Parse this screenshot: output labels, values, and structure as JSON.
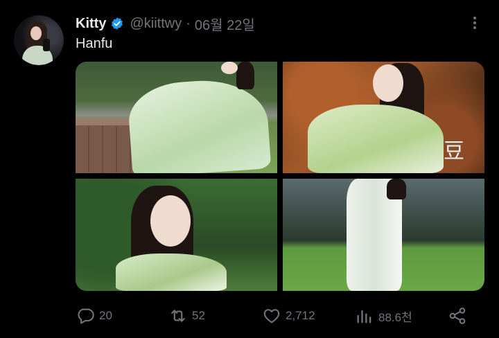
{
  "author": {
    "name": "Kitty",
    "handle": "@kiittwy",
    "separator": "·",
    "date": "06월 22일",
    "verified": true
  },
  "tweet": {
    "text": "Hanfu"
  },
  "media": {
    "photos": [
      {
        "subject": "woman in green hanfu sitting on brick wall in park"
      },
      {
        "subject": "woman in hanfu posing before autumn leaves"
      },
      {
        "subject": "close-up of woman in hanfu with greenery"
      },
      {
        "subject": "woman in white hanfu standing on lawn"
      }
    ],
    "stamp_text": "豆"
  },
  "actions": {
    "reply": {
      "icon": "reply-icon",
      "count": "20"
    },
    "retweet": {
      "icon": "retweet-icon",
      "count": "52"
    },
    "like": {
      "icon": "heart-icon",
      "count": "2,712"
    },
    "views": {
      "icon": "views-icon",
      "count": "88.6천"
    },
    "share": {
      "icon": "share-icon"
    }
  },
  "colors": {
    "background": "#000000",
    "text_primary": "#e7e9ea",
    "text_secondary": "#71767b",
    "verified": "#1d9bf0"
  }
}
